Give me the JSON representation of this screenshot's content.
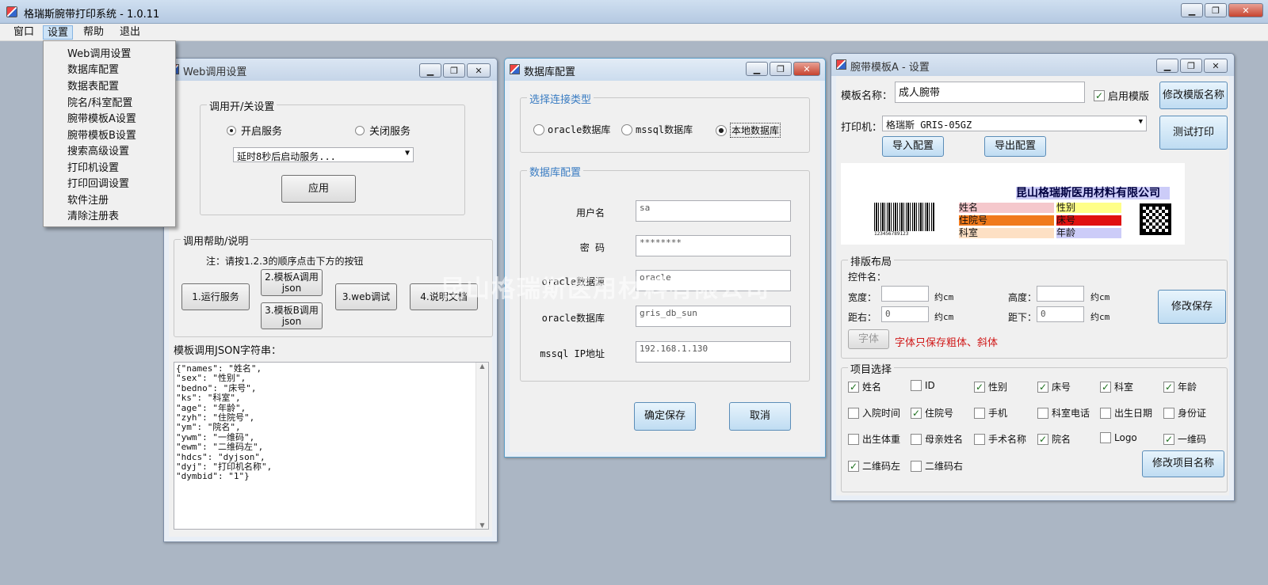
{
  "app": {
    "title": "格瑞斯腕带打印系统 - 1.0.11"
  },
  "menu": {
    "items": [
      "窗口",
      "设置",
      "帮助",
      "退出"
    ]
  },
  "settings_menu": {
    "items": [
      "Web调用设置",
      "数据库配置",
      "数据表配置",
      "院名/科室配置",
      "腕带模板A设置",
      "腕带模板B设置",
      "搜索高级设置",
      "打印机设置",
      "打印回调设置",
      "软件注册",
      "清除注册表"
    ]
  },
  "web_window": {
    "title": "Web调用设置",
    "switch_group": "调用开/关设置",
    "radio_on": "开启服务",
    "radio_off": "关闭服务",
    "delay_select": "延时8秒后启动服务...",
    "apply": "应用",
    "help_group": "调用帮助/说明",
    "note": "注：请按1.2.3的顺序点击下方的按钮",
    "btn_run": "1.运行服务",
    "btn_tpl_a": "2.模板A调用json",
    "btn_tpl_b": "3.模板B调用json",
    "btn_web_debug": "3.web调试",
    "btn_doc": "4.说明文档",
    "json_label": "模板调用JSON字符串：",
    "json_lines": [
      "{\"names\": \"姓名\",",
      "\"sex\": \"性别\",",
      "\"bedno\": \"床号\",",
      "\"ks\": \"科室\",",
      "\"age\": \"年龄\",",
      "\"zyh\": \"住院号\",",
      "\"ym\": \"院名\",",
      "\"ywm\": \"一维码\",",
      "\"ewm\": \"二维码左\",",
      "\"hdcs\": \"dyjson\",",
      "\"dyj\": \"打印机名称\",",
      "\"dymbid\": \"1\"}"
    ]
  },
  "db_window": {
    "title": "数据库配置",
    "conn_group": "选择连接类型",
    "conn_oracle": "oracle数据库",
    "conn_mssql": "mssql数据库",
    "conn_local": "本地数据库",
    "db_group": "数据库配置",
    "fields": [
      {
        "label": "用户名",
        "value": "sa"
      },
      {
        "label": "密  码",
        "value": "********"
      },
      {
        "label": "oracle数据源",
        "value": "oracle"
      },
      {
        "label": "oracle数据库",
        "value": "gris_db_sun"
      },
      {
        "label": "mssql IP地址",
        "value": "192.168.1.130"
      }
    ],
    "save": "确定保存",
    "cancel": "取消"
  },
  "tpl_window": {
    "title": "腕带模板A - 设置",
    "name_label": "模板名称：",
    "name_value": "成人腕带",
    "enable_label": "启用模版",
    "rename_btn": "修改模版名称",
    "printer_label": "打印机：",
    "printer_value": "格瑞斯  GRIS-05GZ",
    "test_print": "测试打印",
    "import_btn": "导入配置",
    "export_btn": "导出配置",
    "preview": {
      "hospital": "昆山格瑞斯医用材料有限公司",
      "barcode_text": "123456789123",
      "cells": [
        {
          "text": "姓名",
          "color": "#f5c8cc"
        },
        {
          "text": "性别",
          "color": "#ffff88"
        },
        {
          "text": "住院号",
          "color": "#f07a1c"
        },
        {
          "text": "床号",
          "color": "#e01010"
        },
        {
          "text": "科室",
          "color": "#fde0c4"
        },
        {
          "text": "年龄",
          "color": "#ccccf8"
        }
      ]
    },
    "layout_group": "排版布局",
    "ctrl_name": "控件名：",
    "width_label": "宽度：",
    "height_label": "高度：",
    "right_label": "距右：",
    "bottom_label": "距下：",
    "right_value": "0",
    "bottom_value": "0",
    "unit": "约cm",
    "save_layout": "修改保存",
    "font_btn": "字体",
    "font_note": "字体只保存粗体、斜体",
    "items_group": "项目选择",
    "items": [
      {
        "label": "姓名",
        "checked": true
      },
      {
        "label": "ID",
        "checked": false
      },
      {
        "label": "性别",
        "checked": true
      },
      {
        "label": "床号",
        "checked": true
      },
      {
        "label": "科室",
        "checked": true
      },
      {
        "label": "年龄",
        "checked": true
      },
      {
        "label": "入院时间",
        "checked": false
      },
      {
        "label": "住院号",
        "checked": true
      },
      {
        "label": "手机",
        "checked": false
      },
      {
        "label": "科室电话",
        "checked": false
      },
      {
        "label": "出生日期",
        "checked": false
      },
      {
        "label": "身份证",
        "checked": false
      },
      {
        "label": "出生体重",
        "checked": false
      },
      {
        "label": "母亲姓名",
        "checked": false
      },
      {
        "label": "手术名称",
        "checked": false
      },
      {
        "label": "院名",
        "checked": true
      },
      {
        "label": "Logo",
        "checked": false
      },
      {
        "label": "一维码",
        "checked": true
      },
      {
        "label": "二维码左",
        "checked": true
      },
      {
        "label": "二维码右",
        "checked": false
      }
    ],
    "rename_items_btn": "修改项目名称"
  },
  "watermark": "昆山格瑞斯医用材料有限公司",
  "colors": {
    "accent_blue": "#3a7cc2",
    "warning_red": "#d01818"
  }
}
